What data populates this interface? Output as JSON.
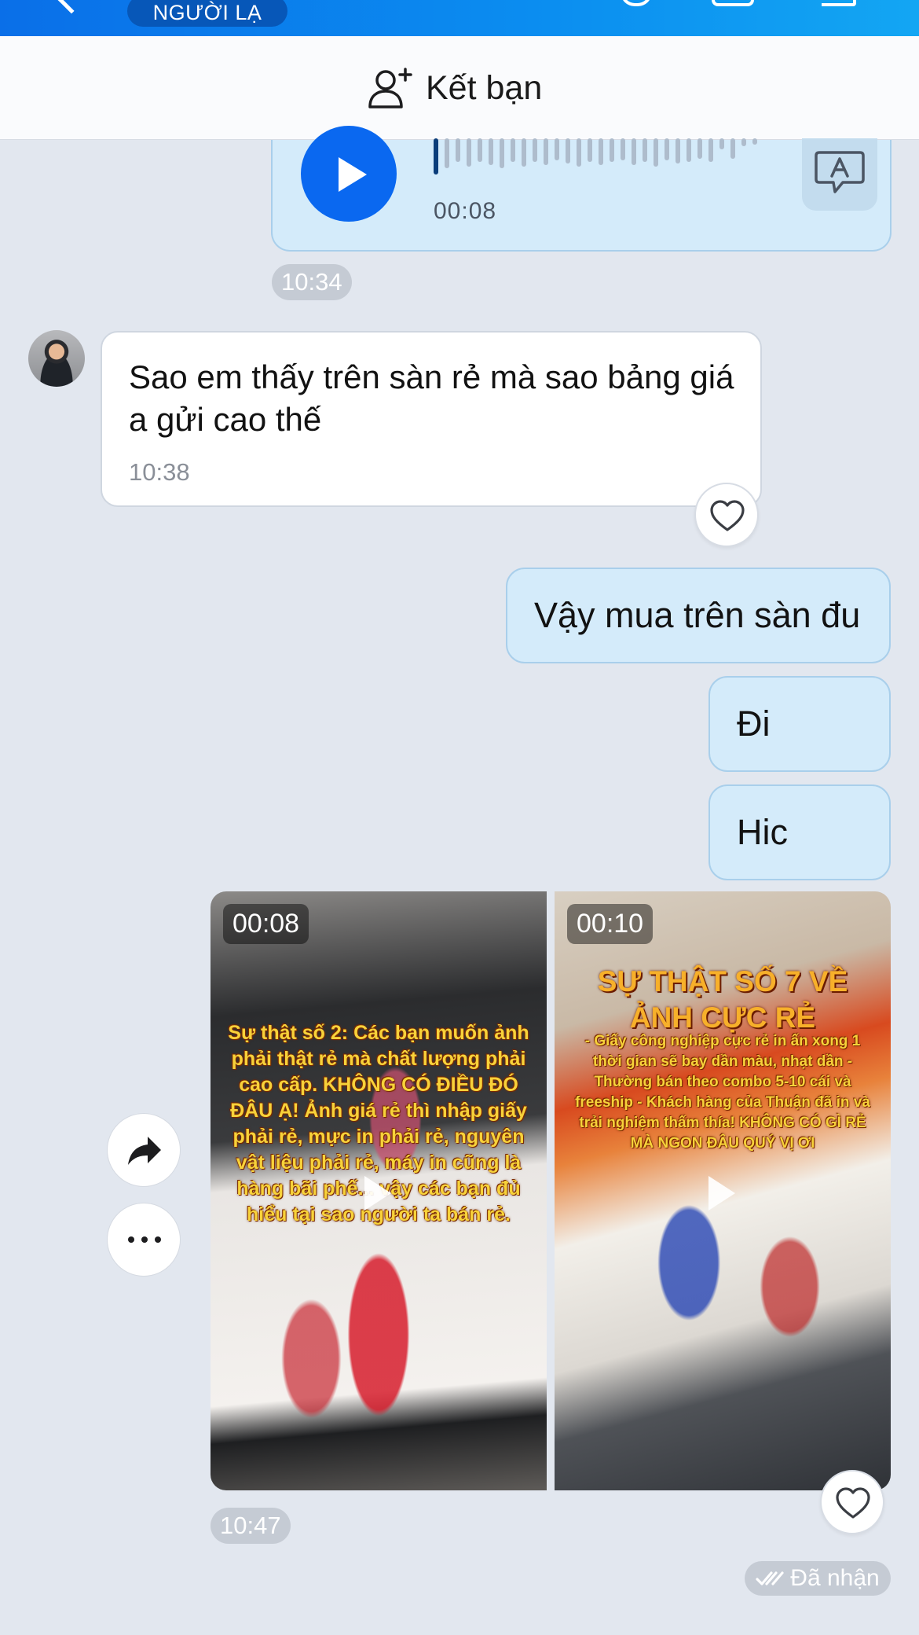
{
  "header": {
    "badge": "NGƯỜI LẠ",
    "add_friend_label": "Kết bạn"
  },
  "voice_message": {
    "duration": "00:08",
    "time": "10:34"
  },
  "received_message": {
    "text": "Sao em thấy trên sàn rẻ mà sao bảng giá a gửi cao thế",
    "time": "10:38"
  },
  "sent_messages": [
    {
      "text": "Vậy mua trên sàn đu"
    },
    {
      "text": "Đi"
    },
    {
      "text": "Hic"
    }
  ],
  "videos": [
    {
      "duration": "00:08",
      "caption": "Sự thật số 2: Các bạn muốn ảnh phải thật rẻ mà chất lượng phải cao cấp. KHÔNG CÓ ĐIỀU ĐÓ ĐÂU Ạ! Ảnh giá rẻ thì nhập giấy phải rẻ, mực in phải rẻ, nguyên vật liệu phải rẻ, máy in cũng là hàng bãi phế... vậy các bạn đủ hiểu tại sao người ta bán rẻ."
    },
    {
      "duration": "00:10",
      "title": "SỰ THẬT SỐ 7 VỀ ẢNH CỰC RẺ",
      "caption": "- Giấy công nghiệp cực rẻ in ấn xong 1 thời gian sẽ bay dần màu, nhạt dần - Thường bán theo combo 5-10 cái và freeship - Khách hàng của Thuận đã in và trải nghiệm thấm thía! KHÔNG CÓ GÌ RẺ MÀ NGON ĐÂU QUÝ VỊ ƠI"
    }
  ],
  "video_time": "10:47",
  "receipt_status": "Đã nhận",
  "colors": {
    "header_blue": "#0a6fe8",
    "sent_bubble": "#d4ebfa",
    "received_bubble": "#ffffff",
    "chat_background": "#e2e7ef",
    "play_button": "#0a68f0"
  },
  "icons": [
    "back-chevron-icon",
    "add-friend-icon",
    "play-icon",
    "transcribe-icon",
    "heart-icon",
    "forward-icon",
    "more-icon",
    "double-check-icon"
  ]
}
